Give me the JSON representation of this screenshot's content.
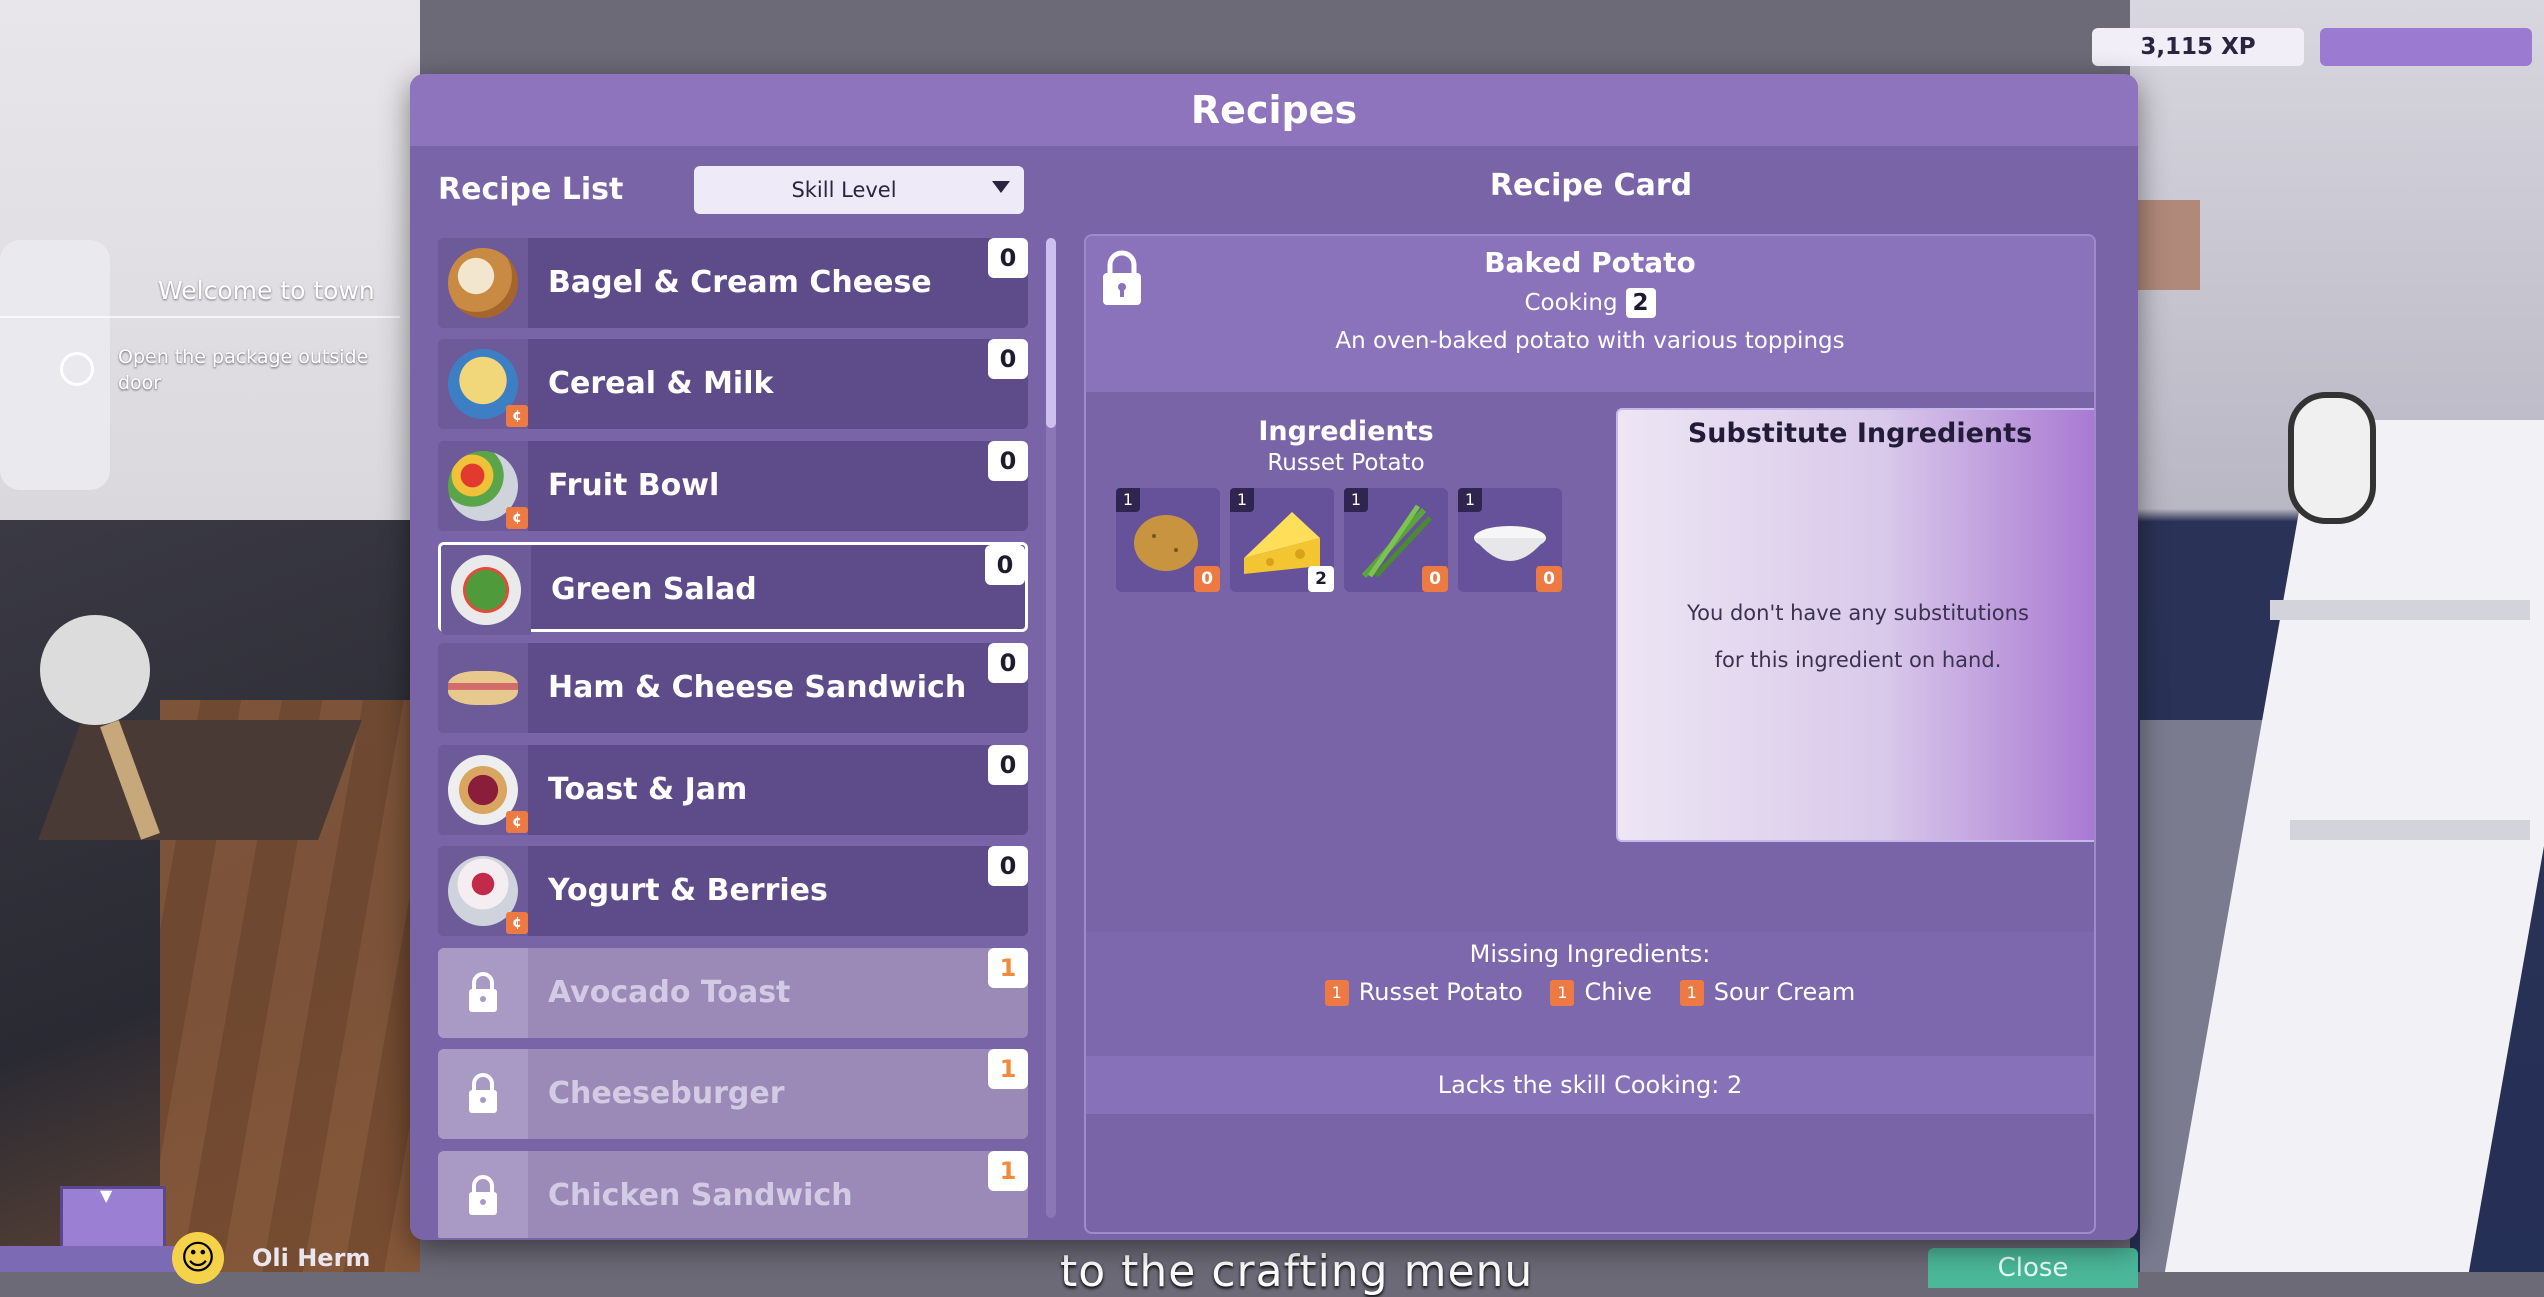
{
  "hud": {
    "quest_title": "Welcome to town",
    "quest_task": "Open the package outside door",
    "xp": "3,115 XP",
    "player_name": "Oli Herm",
    "subtitle": "to the crafting menu",
    "close_label": "Close"
  },
  "panel": {
    "title": "Recipes",
    "list_heading": "Recipe List",
    "sort_dropdown": {
      "selected": "Skill Level"
    },
    "recipes": [
      {
        "name": "Bagel & Cream Cheese",
        "count": "0",
        "locked": false,
        "flag": ""
      },
      {
        "name": "Cereal & Milk",
        "count": "0",
        "locked": false,
        "flag": "¢"
      },
      {
        "name": "Fruit Bowl",
        "count": "0",
        "locked": false,
        "flag": "¢"
      },
      {
        "name": "Green Salad",
        "count": "0",
        "locked": false,
        "flag": "",
        "selected": true
      },
      {
        "name": "Ham & Cheese Sandwich",
        "count": "0",
        "locked": false,
        "flag": ""
      },
      {
        "name": "Toast & Jam",
        "count": "0",
        "locked": false,
        "flag": "¢"
      },
      {
        "name": "Yogurt & Berries",
        "count": "0",
        "locked": false,
        "flag": "¢"
      },
      {
        "name": "Avocado Toast",
        "count": "1",
        "locked": true
      },
      {
        "name": "Cheeseburger",
        "count": "1",
        "locked": true
      },
      {
        "name": "Chicken Sandwich",
        "count": "1",
        "locked": true
      }
    ]
  },
  "card": {
    "heading": "Recipe Card",
    "name": "Baked Potato",
    "skill": "Cooking",
    "skill_level": "2",
    "description": "An oven-baked potato with various toppings",
    "ingredients_heading": "Ingredients",
    "ingredients_sub": "Russet Potato",
    "ingredients": [
      {
        "icon": "potato-icon",
        "qty": "1",
        "have": "0"
      },
      {
        "icon": "cheese-icon",
        "qty": "1",
        "have": "2"
      },
      {
        "icon": "chive-icon",
        "qty": "1",
        "have": "0"
      },
      {
        "icon": "sour-cream-icon",
        "qty": "1",
        "have": "0"
      }
    ],
    "substitute_heading": "Substitute Ingredients",
    "substitute_text_1": "You don't have any substitutions",
    "substitute_text_2": "for this ingredient on hand.",
    "missing_heading": "Missing Ingredients:",
    "missing": [
      {
        "qty": "1",
        "name": "Russet Potato"
      },
      {
        "qty": "1",
        "name": "Chive"
      },
      {
        "qty": "1",
        "name": "Sour Cream"
      }
    ],
    "lacks_skill": "Lacks the skill Cooking: 2"
  },
  "colors": {
    "panel": "#7a64a8",
    "header": "#8d74bd",
    "accent_orange": "#ee7a43",
    "close_green": "#4bb899"
  }
}
